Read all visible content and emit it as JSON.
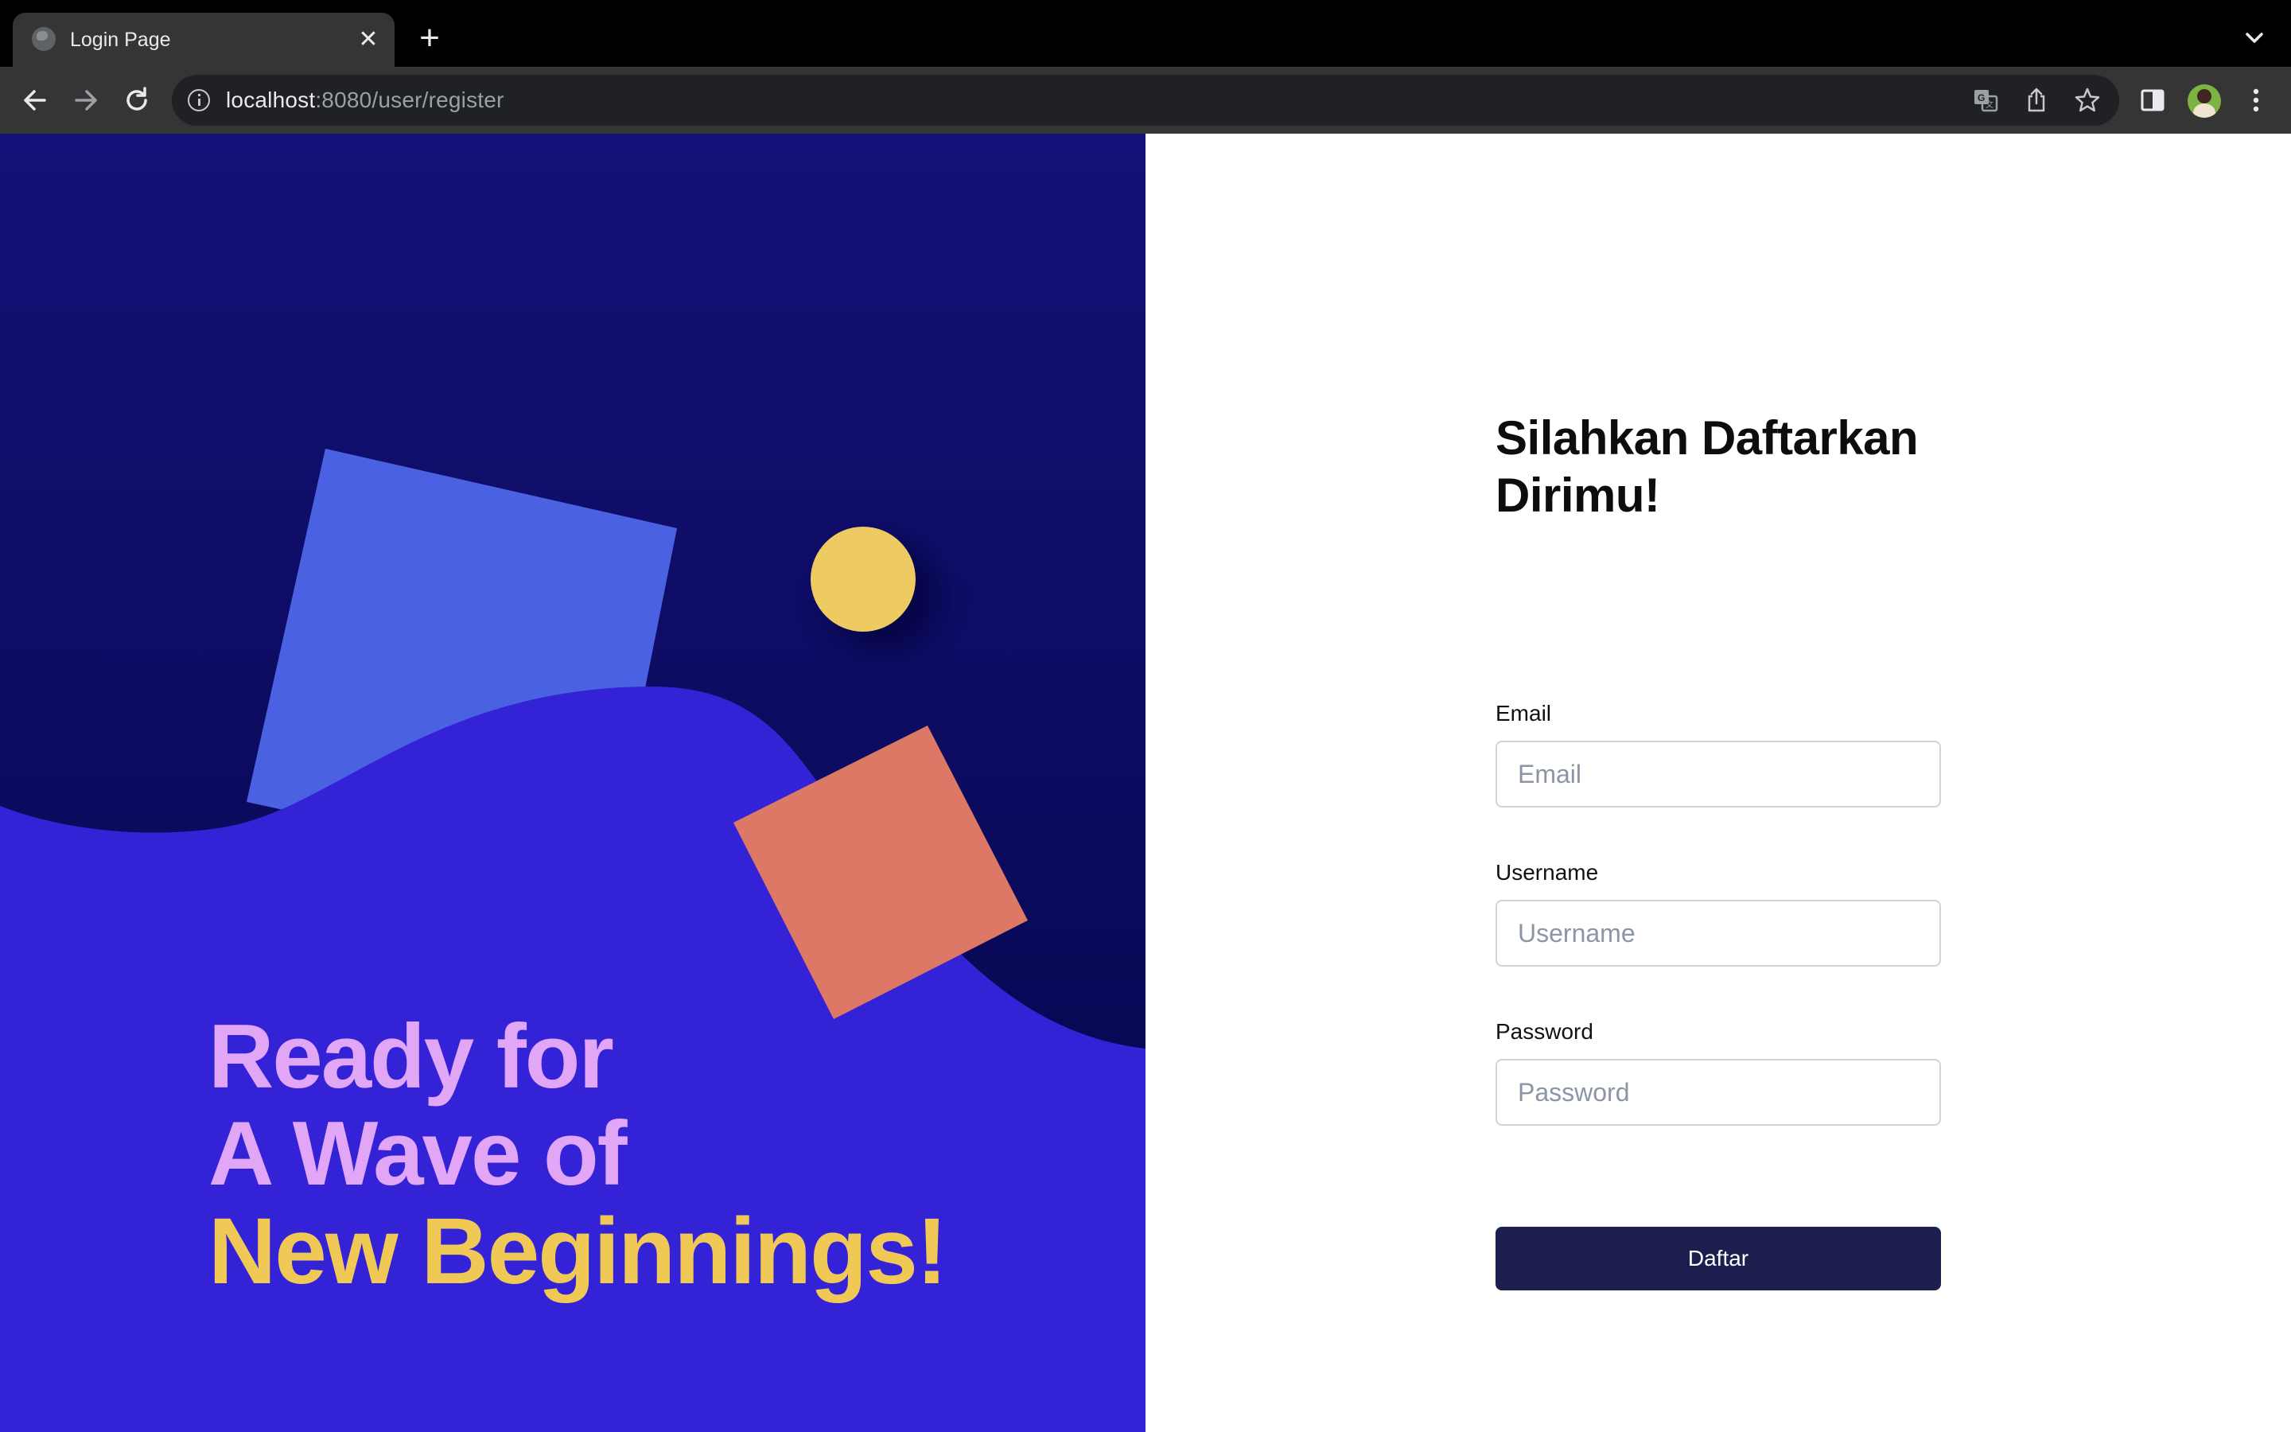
{
  "browser": {
    "tab_title": "Login Page",
    "url_host": "localhost",
    "url_path": ":8080/user/register"
  },
  "icons": {
    "tab_favicon": "globe-icon",
    "tab_close": "close-icon",
    "new_tab": "plus-icon",
    "tab_menu": "chevron-down-icon",
    "back": "arrow-left-icon",
    "forward": "arrow-right-icon",
    "reload": "reload-icon",
    "site_info": "info-icon",
    "translate": "translate-icon",
    "share": "share-icon",
    "bookmark": "star-icon",
    "side_panel": "side-panel-icon",
    "profile": "avatar",
    "menu": "kebab-menu-icon"
  },
  "hero": {
    "line1": "Ready for",
    "line2": "A Wave of",
    "line3": "New Beginnings!",
    "colors": {
      "background_top": "#141178",
      "background_bottom": "#04044a",
      "wave": "#3422d6",
      "square_blue": "#4a62e2",
      "square_coral": "#de7866",
      "circle_yellow": "#eecb62",
      "text_pink": "#e2a6f7",
      "text_yellow": "#f0c855"
    }
  },
  "form": {
    "title": "Silahkan Daftarkan Dirimu!",
    "email_label": "Email",
    "email_placeholder": "Email",
    "email_value": "",
    "username_label": "Username",
    "username_placeholder": "Username",
    "username_value": "",
    "password_label": "Password",
    "password_placeholder": "Password",
    "password_value": "",
    "submit_label": "Daftar",
    "button_color": "#1c1e4e"
  }
}
